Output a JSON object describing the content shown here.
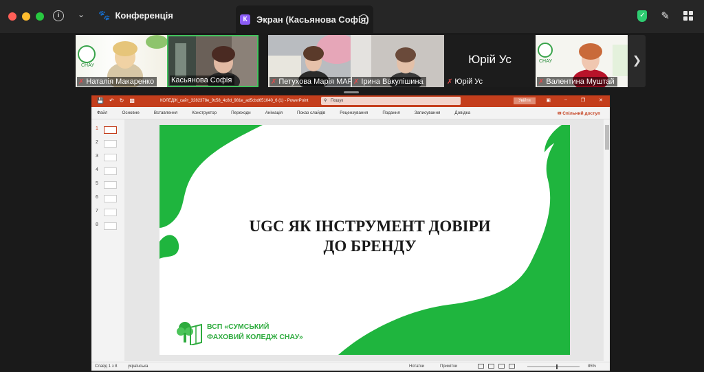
{
  "zoom": {
    "meeting_title": "Конференція",
    "share_tab_badge": "К",
    "share_tab_title": "Экран (Касьянова Софія)",
    "participants": [
      {
        "name": "Наталія Макаренко",
        "muted": true
      },
      {
        "name": "Касьянова Софія",
        "muted": false
      },
      {
        "name": "Петухова Марія МАР",
        "muted": true
      },
      {
        "name": "Ірина Вакулішина",
        "muted": true
      },
      {
        "name": "Юрій Ус",
        "muted": true,
        "big_label": "Юрій Ус"
      },
      {
        "name": "Валентина Муштай",
        "muted": true
      }
    ],
    "colors": {
      "accent_green": "#2ecc71",
      "speaker_border": "#42c35d"
    }
  },
  "ppt": {
    "file_name": "КОЛЕДЖ_сайт_3282378e_9c58_4c8d_981e_ad5cbd651040_6 (1)  -  PowerPoint",
    "search_placeholder": "Пошук",
    "sign_in": "Увійти",
    "share_label": "Спільний доступ",
    "menu": [
      "Файл",
      "Основне",
      "Вставлення",
      "Конструктор",
      "Переходи",
      "Анімація",
      "Показ слайдів",
      "Рецензування",
      "Подання",
      "Записування",
      "Довідка"
    ],
    "thumbnails": [
      "1",
      "2",
      "3",
      "4",
      "5",
      "6",
      "7",
      "8"
    ],
    "slide": {
      "title_line1": "UGC ЯК ІНСТРУМЕНТ ДОВІРИ",
      "title_line2": "ДО БРЕНДУ",
      "logo_line1": "ВСП «СУМСЬКИЙ",
      "logo_line2": "ФАХОВИЙ КОЛЕДЖ СНАУ»"
    },
    "status": {
      "slide_info": "Слайд 1 з 8",
      "language": "українська",
      "notes": "Нотатки",
      "comments": "Примітки",
      "zoom": "85%"
    },
    "colors": {
      "brand": "#c43e1c",
      "slide_green": "#1fb53e"
    }
  }
}
